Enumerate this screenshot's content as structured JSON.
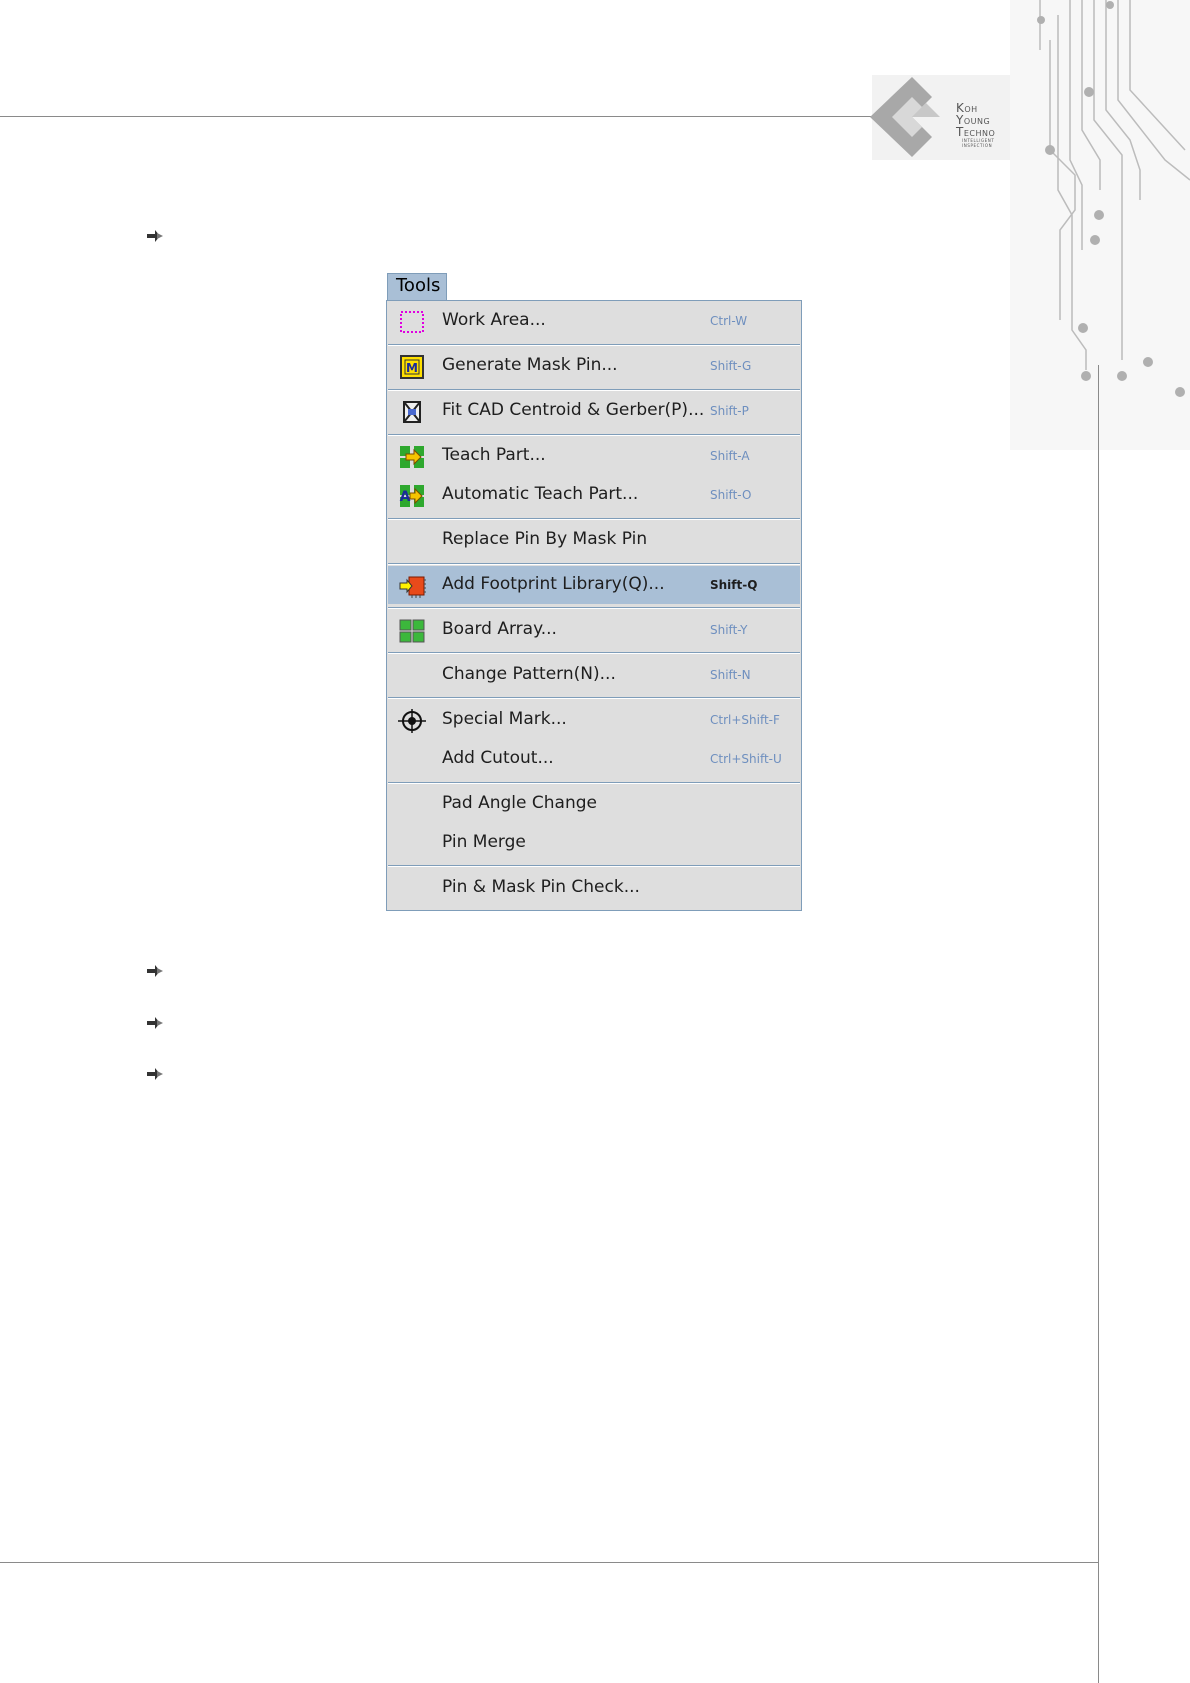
{
  "logo": {
    "line1": "Koh",
    "line2": "Young",
    "line3": "Techno",
    "line4": "INTELLIGENT",
    "line5": "INSPECTION"
  },
  "menu": {
    "title": "Tools",
    "items": [
      {
        "label": "Work Area...",
        "shortcut": "Ctrl-W",
        "icon": "work-area-icon"
      },
      {
        "label": "Generate Mask Pin...",
        "shortcut": "Shift-G",
        "icon": "mask-pin-icon"
      },
      {
        "label": "Fit CAD Centroid & Gerber(P)...",
        "shortcut": "Shift-P",
        "icon": "fit-cad-icon"
      },
      {
        "label": "Teach Part...",
        "shortcut": "Shift-A",
        "icon": "teach-part-icon"
      },
      {
        "label": "Automatic Teach Part...",
        "shortcut": "Shift-O",
        "icon": "auto-teach-icon"
      },
      {
        "label": "Replace Pin By Mask Pin",
        "shortcut": "",
        "icon": ""
      },
      {
        "label": "Add Footprint Library(Q)...",
        "shortcut": "Shift-Q",
        "icon": "footprint-library-icon",
        "highlighted": true
      },
      {
        "label": "Board Array...",
        "shortcut": "Shift-Y",
        "icon": "board-array-icon"
      },
      {
        "label": "Change Pattern(N)...",
        "shortcut": "Shift-N",
        "icon": ""
      },
      {
        "label": "Special Mark...",
        "shortcut": "Ctrl+Shift-F",
        "icon": "crosshair-icon"
      },
      {
        "label": "Add Cutout...",
        "shortcut": "Ctrl+Shift-U",
        "icon": ""
      },
      {
        "label": "Pad Angle Change",
        "shortcut": "",
        "icon": ""
      },
      {
        "label": "Pin Merge",
        "shortcut": "",
        "icon": ""
      },
      {
        "label": "Pin & Mask Pin Check...",
        "shortcut": "",
        "icon": ""
      }
    ]
  },
  "colors": {
    "menu_bg": "#dedede",
    "highlight": "#a9bfd6",
    "border": "#7f9db9",
    "shortcut": "#6e8fbf"
  }
}
